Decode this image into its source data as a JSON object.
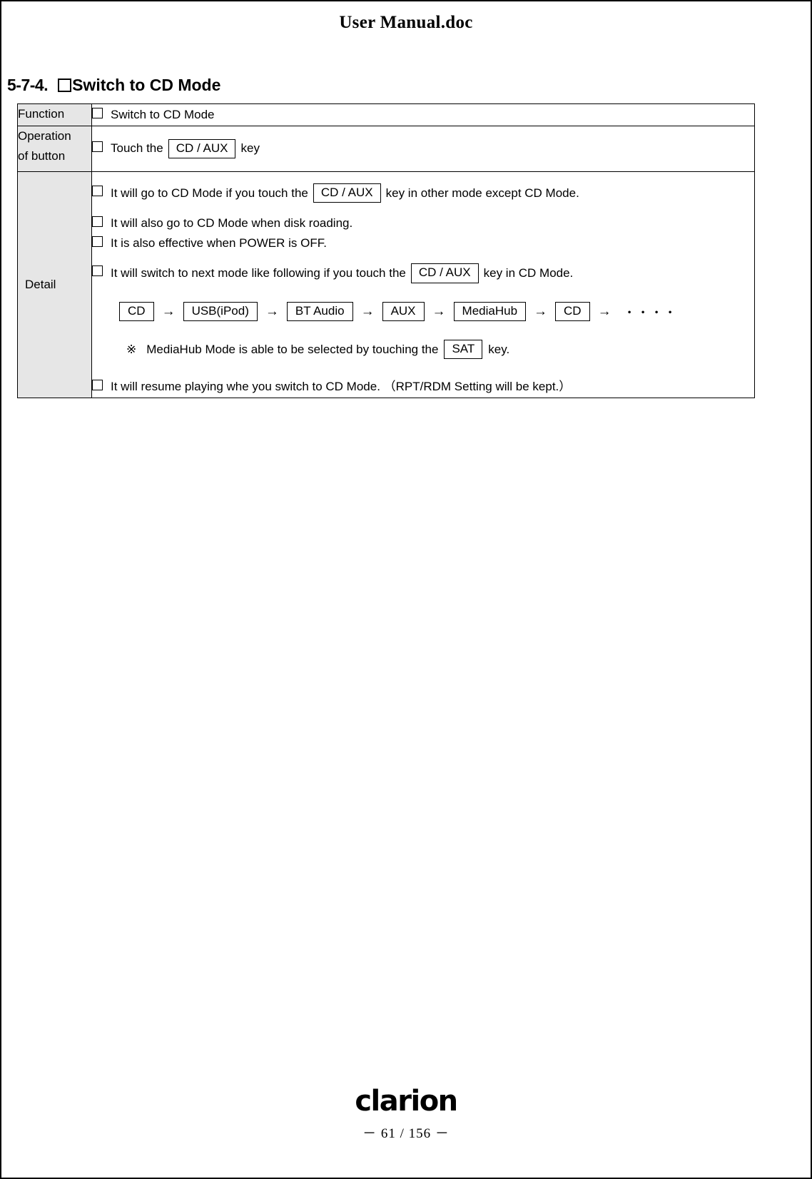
{
  "document": {
    "header_title": "User Manual.doc"
  },
  "section": {
    "number": "5-7-4.",
    "title": "Switch to CD Mode"
  },
  "table": {
    "rows": {
      "function": {
        "label": "Function",
        "text": "Switch to CD Mode"
      },
      "operation": {
        "label_line1": "Operation",
        "label_line2": "of button",
        "text_before": "Touch the",
        "key": "CD / AUX",
        "text_after": "key"
      },
      "detail": {
        "label": "Detail",
        "bullets": [
          {
            "text_before": "It will go to CD Mode if you touch the",
            "key": "CD / AUX",
            "text_after": "key in other mode except CD Mode."
          },
          {
            "text_before": "It will also go to CD Mode when disk roading.",
            "key": "",
            "text_after": ""
          },
          {
            "text_before": "It is also effective when POWER is OFF.",
            "key": "",
            "text_after": ""
          },
          {
            "text_before": "It will switch to next mode like following if you touch the",
            "key": "CD / AUX",
            "text_after": "key in CD Mode."
          }
        ],
        "mode_chain": {
          "items": [
            "CD",
            "USB(iPod)",
            "BT Audio",
            "AUX",
            "MediaHub",
            "CD"
          ],
          "arrow": "→",
          "trailing": "→",
          "dots": "・・・・"
        },
        "note": {
          "mark": "※",
          "text_before": "MediaHub Mode is able to be selected by touching the",
          "key": "SAT",
          "text_after": "key."
        },
        "last_bullet": {
          "text": "It will resume playing whe you switch to CD Mode. （RPT/RDM Setting will be kept.）"
        }
      }
    }
  },
  "footer": {
    "brand": "clarion",
    "page_number": "－ 61 / 156 －"
  }
}
